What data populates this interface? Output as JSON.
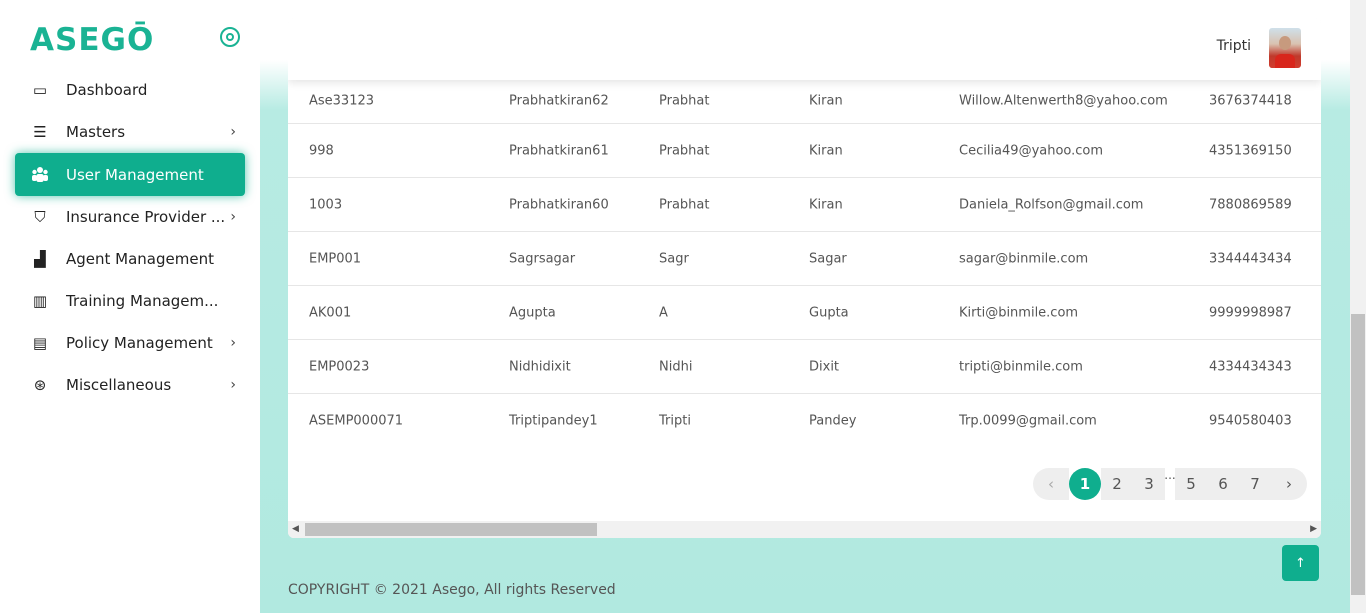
{
  "brand": {
    "logo_text": "ASEGŌ"
  },
  "sidebar": {
    "items": [
      {
        "label": "Dashboard",
        "icon": "dashboard-icon",
        "glyph": "▭",
        "has_chevron": false
      },
      {
        "label": "Masters",
        "icon": "list-icon",
        "glyph": "☰",
        "has_chevron": true
      },
      {
        "label": "User Management",
        "icon": "users-icon",
        "glyph": "👥",
        "has_chevron": false,
        "active": true
      },
      {
        "label": "Insurance Provider ...",
        "icon": "shield-icon",
        "glyph": "⛉",
        "has_chevron": true
      },
      {
        "label": "Agent Management",
        "icon": "agent-chart-icon",
        "glyph": "▟",
        "has_chevron": false
      },
      {
        "label": "Training Managem...",
        "icon": "books-icon",
        "glyph": "▥",
        "has_chevron": false
      },
      {
        "label": "Policy Management",
        "icon": "document-icon",
        "glyph": "▤",
        "has_chevron": true
      },
      {
        "label": "Miscellaneous",
        "icon": "lifebuoy-icon",
        "glyph": "⊛",
        "has_chevron": true
      }
    ],
    "chevron": "›"
  },
  "header": {
    "user_name": "Tripti"
  },
  "table": {
    "rows": [
      [
        "Ase33123",
        "Prabhatkiran62",
        "Prabhat",
        "Kiran",
        "Willow.Altenwerth8@yahoo.com",
        "3676374418"
      ],
      [
        "998",
        "Prabhatkiran61",
        "Prabhat",
        "Kiran",
        "Cecilia49@yahoo.com",
        "4351369150"
      ],
      [
        "1003",
        "Prabhatkiran60",
        "Prabhat",
        "Kiran",
        "Daniela_Rolfson@gmail.com",
        "7880869589"
      ],
      [
        "EMP001",
        "Sagrsagar",
        "Sagr",
        "Sagar",
        "sagar@binmile.com",
        "3344443434"
      ],
      [
        "AK001",
        "Agupta",
        "A",
        "Gupta",
        "Kirti@binmile.com",
        "9999998987"
      ],
      [
        "EMP0023",
        "Nidhidixit",
        "Nidhi",
        "Dixit",
        "tripti@binmile.com",
        "4334434343"
      ],
      [
        "ASEMP000071",
        "Triptipandey1",
        "Tripti",
        "Pandey",
        "Trp.0099@gmail.com",
        "9540580403"
      ]
    ]
  },
  "pagination": {
    "prev": "‹",
    "pages_before": [
      "1",
      "2",
      "3"
    ],
    "dots": "...",
    "pages_after": [
      "5",
      "6",
      "7"
    ],
    "next": "›",
    "current": "1"
  },
  "scroll_top": {
    "glyph": "↑"
  },
  "footer": {
    "text": "COPYRIGHT © 2021 Asego, All rights Reserved"
  },
  "colors": {
    "accent": "#0fae8e",
    "background_tint": "#b1e9e0"
  }
}
